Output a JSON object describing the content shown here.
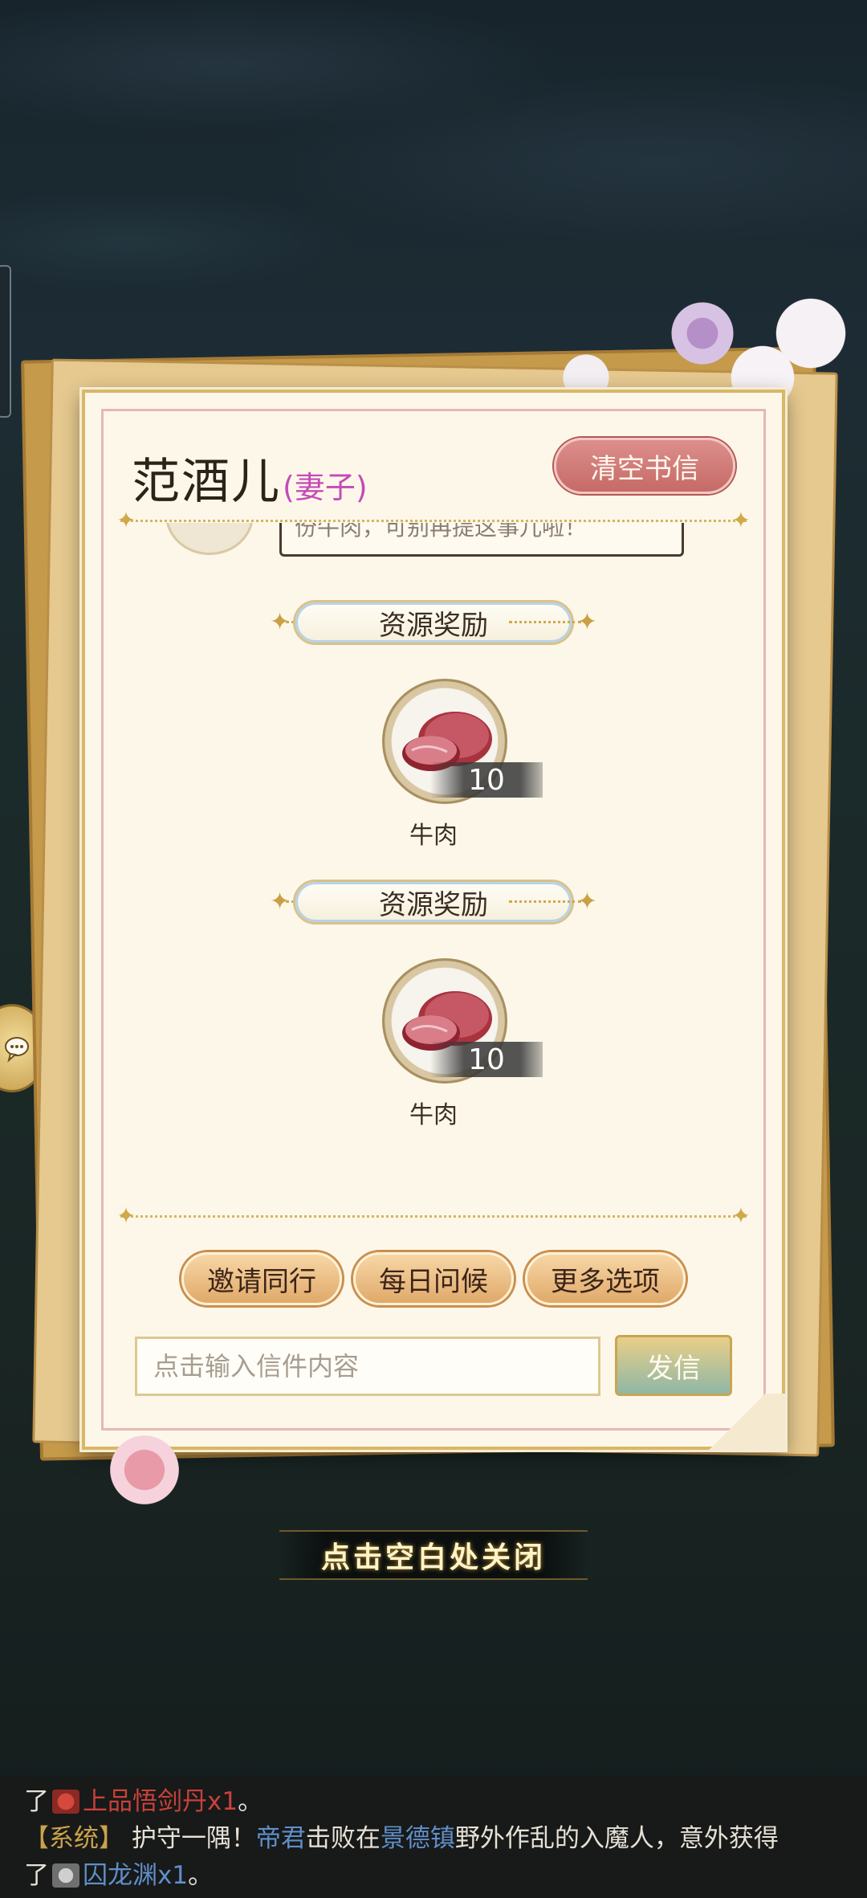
{
  "letter": {
    "sender_name": "范酒儿",
    "sender_role": "(妻子)",
    "clear_button": "清空书信",
    "message_preview": "份牛肉，可别再提这事儿啦！",
    "rewards": [
      {
        "heading": "资源奖励",
        "item_name": "牛肉",
        "quantity": "10"
      },
      {
        "heading": "资源奖励",
        "item_name": "牛肉",
        "quantity": "10"
      }
    ],
    "actions": {
      "invite": "邀请同行",
      "daily_greeting": "每日问候",
      "more_options": "更多选项"
    },
    "input_placeholder": "点击输入信件内容",
    "send_button": "发信"
  },
  "close_hint": "点击空白处关闭",
  "chat": {
    "line1_prefix": "了",
    "line1_item": "上品悟剑丹x1",
    "line1_suffix": "。",
    "line2_tag": "【系统】",
    "line2_text1": "护守一隅！",
    "line2_name": "帝君",
    "line2_text2": "击败在",
    "line2_place": "景德镇",
    "line2_text3": "野外作乱的入魔人，意外获得",
    "line3_prefix": "了",
    "line3_item": "囚龙渊x1",
    "line3_suffix": "。"
  }
}
